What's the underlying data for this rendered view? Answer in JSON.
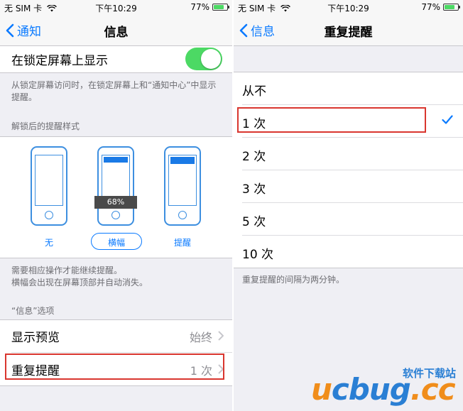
{
  "status": {
    "carrier": "无 SIM 卡",
    "time": "下午10:29",
    "battery": "77%",
    "battery_level": 0.77
  },
  "left": {
    "nav": {
      "back": "通知",
      "title": "信息"
    },
    "lock_screen": {
      "label": "在锁定屏幕上显示",
      "enabled": true
    },
    "lock_note": "从锁定屏幕访问时，在锁定屏幕上和“通知中心”中显示提醒。",
    "alert_style_header": "解锁后的提醒样式",
    "alert_styles": [
      {
        "label": "无"
      },
      {
        "label": "横幅"
      },
      {
        "label": "提醒"
      }
    ],
    "percent_tag": "68%",
    "style_note_1": "需要相应操作才能继续提醒。",
    "style_note_2": "横幅会出现在屏幕顶部并自动消失。",
    "options_header": "“信息”选项",
    "show_preview": {
      "label": "显示预览",
      "value": "始终"
    },
    "repeat_alerts": {
      "label": "重复提醒",
      "value": "1 次"
    }
  },
  "right": {
    "nav": {
      "back": "信息",
      "title": "重复提醒"
    },
    "options": [
      "从不",
      "1 次",
      "2 次",
      "3 次",
      "5 次",
      "10 次"
    ],
    "selected_index": 1,
    "note": "重复提醒的间隔为两分钟。"
  },
  "watermark": {
    "main_u": "u",
    "main_rest": "cbug",
    "main_dot": ".cc",
    "tagline": "软件下载站"
  },
  "colors": {
    "accent": "#0a7aff",
    "switch_on": "#4cd964",
    "highlight": "#d9362f",
    "watermark_orange": "#f08d1b",
    "watermark_blue": "#2a7fd4"
  }
}
